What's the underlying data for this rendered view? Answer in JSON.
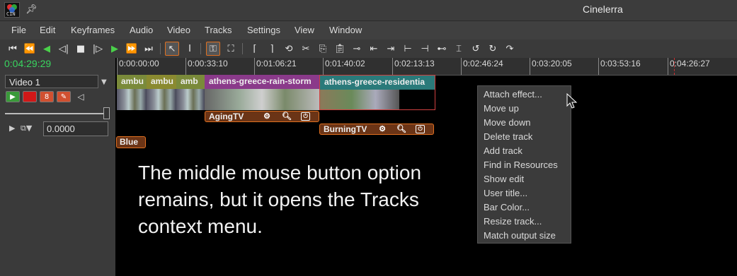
{
  "window": {
    "title": "Cinelerra",
    "app_icon_text": "CIN"
  },
  "menubar": [
    "File",
    "Edit",
    "Keyframes",
    "Audio",
    "Video",
    "Tracks",
    "Settings",
    "Window"
  ],
  "timeline": {
    "current_time": "0:04:29:29",
    "ruler_labels": [
      "0:00:00:00",
      "0:00:33:10",
      "0:01:06:21",
      "0:01:40:02",
      "0:02:13:13",
      "0:02:46:24",
      "0:03:20:05",
      "0:03:53:16",
      "0:04:26:27"
    ]
  },
  "track": {
    "name": "Video 1",
    "value": "0.0000"
  },
  "clips": [
    {
      "label": "ambu",
      "color": "#7a8a3a"
    },
    {
      "label": "ambu",
      "color": "#8a8a30"
    },
    {
      "label": "amb",
      "color": "#7a8a3a"
    },
    {
      "label": "athens-greece-rain-storm",
      "color": "#8a3a8a"
    },
    {
      "label": "athens-greece-residentia",
      "color": "#2a7a7a"
    }
  ],
  "plugins": {
    "aging": "AgingTV",
    "burning": "BurningTV",
    "blue": "Blue"
  },
  "caption": "The middle mouse button option remains, but it opens the Tracks context menu.",
  "context_menu": [
    "Attach effect...",
    "Move up",
    "Move down",
    "Delete track",
    "Add track",
    "Find in Resources",
    "Show edit",
    "User title...",
    "Bar Color...",
    "Resize track...",
    "Match output size"
  ]
}
